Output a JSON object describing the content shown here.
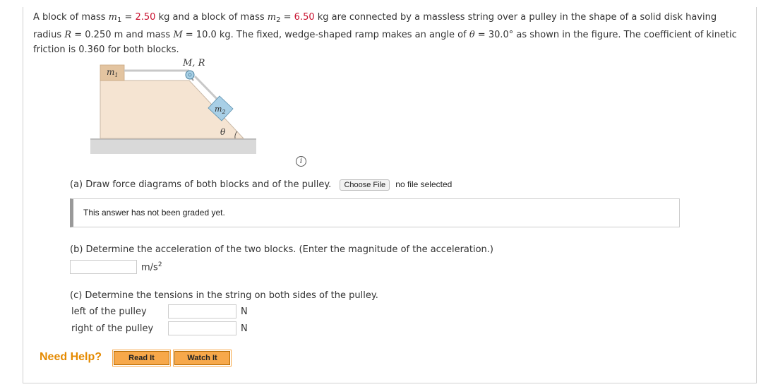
{
  "problem": {
    "p1": "A block of mass ",
    "m1_sym": "m",
    "m1_sub": "1",
    "eq1": " = ",
    "m1_val": "2.50",
    "p2": " kg and a block of mass ",
    "m2_sym": "m",
    "m2_sub": "2",
    "eq2": " = ",
    "m2_val": "6.50",
    "p3": " kg are connected by a massless string over a pulley in the shape of a solid disk having",
    "p4": "radius ",
    "R_sym": "R",
    "p5": " = 0.250 m and mass ",
    "M_sym": "M",
    "p6": " = 10.0 kg. The fixed, wedge-shaped ramp makes an angle of ",
    "theta_sym": "θ",
    "p7": " = 30.0° as shown in the figure. The coefficient of kinetic",
    "p8": "friction is 0.360 for both blocks."
  },
  "figure": {
    "m1_label": "m",
    "m1_label_sub": "1",
    "m2_label": "m",
    "m2_label_sub": "2",
    "pulley_label": "M, R",
    "angle_label": "θ"
  },
  "info_icon": "i",
  "part_a": {
    "question": "(a) Draw force diagrams of both blocks and of the pulley.",
    "choose_file": "Choose File",
    "no_file": "no file selected",
    "graded_text": "This answer has not been graded yet."
  },
  "part_b": {
    "question": "(b) Determine the acceleration of the two blocks. (Enter the magnitude of the acceleration.)",
    "unit": "m/s",
    "unit_sup": "2"
  },
  "part_c": {
    "question": "(c) Determine the tensions in the string on both sides of the pulley.",
    "left_label": "left of the pulley",
    "right_label": "right of the pulley",
    "unit_left": "N",
    "unit_right": "N"
  },
  "help": {
    "label": "Need Help?",
    "read_it": "Read It",
    "watch_it": "Watch It"
  }
}
